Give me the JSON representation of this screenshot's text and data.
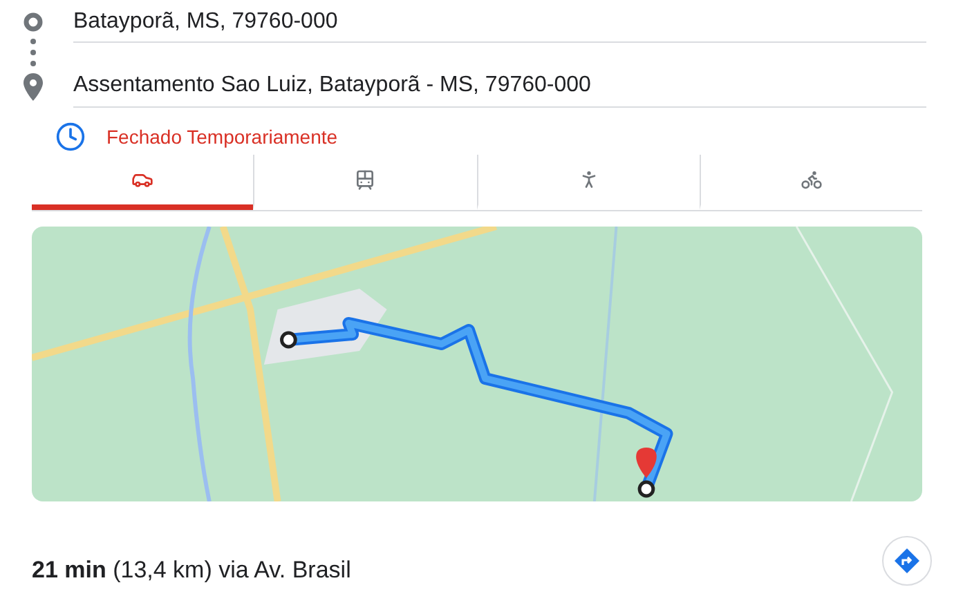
{
  "origin": {
    "value": "Batayporã, MS, 79760-000"
  },
  "destination": {
    "value": "Assentamento Sao Luiz, Batayporã - MS, 79760-000"
  },
  "status": {
    "text": "Fechado Temporariamente"
  },
  "travel_modes": [
    {
      "kind": "car",
      "selected": true
    },
    {
      "kind": "transit",
      "selected": false
    },
    {
      "kind": "walk",
      "selected": false
    },
    {
      "kind": "bike",
      "selected": false
    }
  ],
  "route": {
    "summary": "**21 min** (13,4 km) via Av. Brasil"
  }
}
